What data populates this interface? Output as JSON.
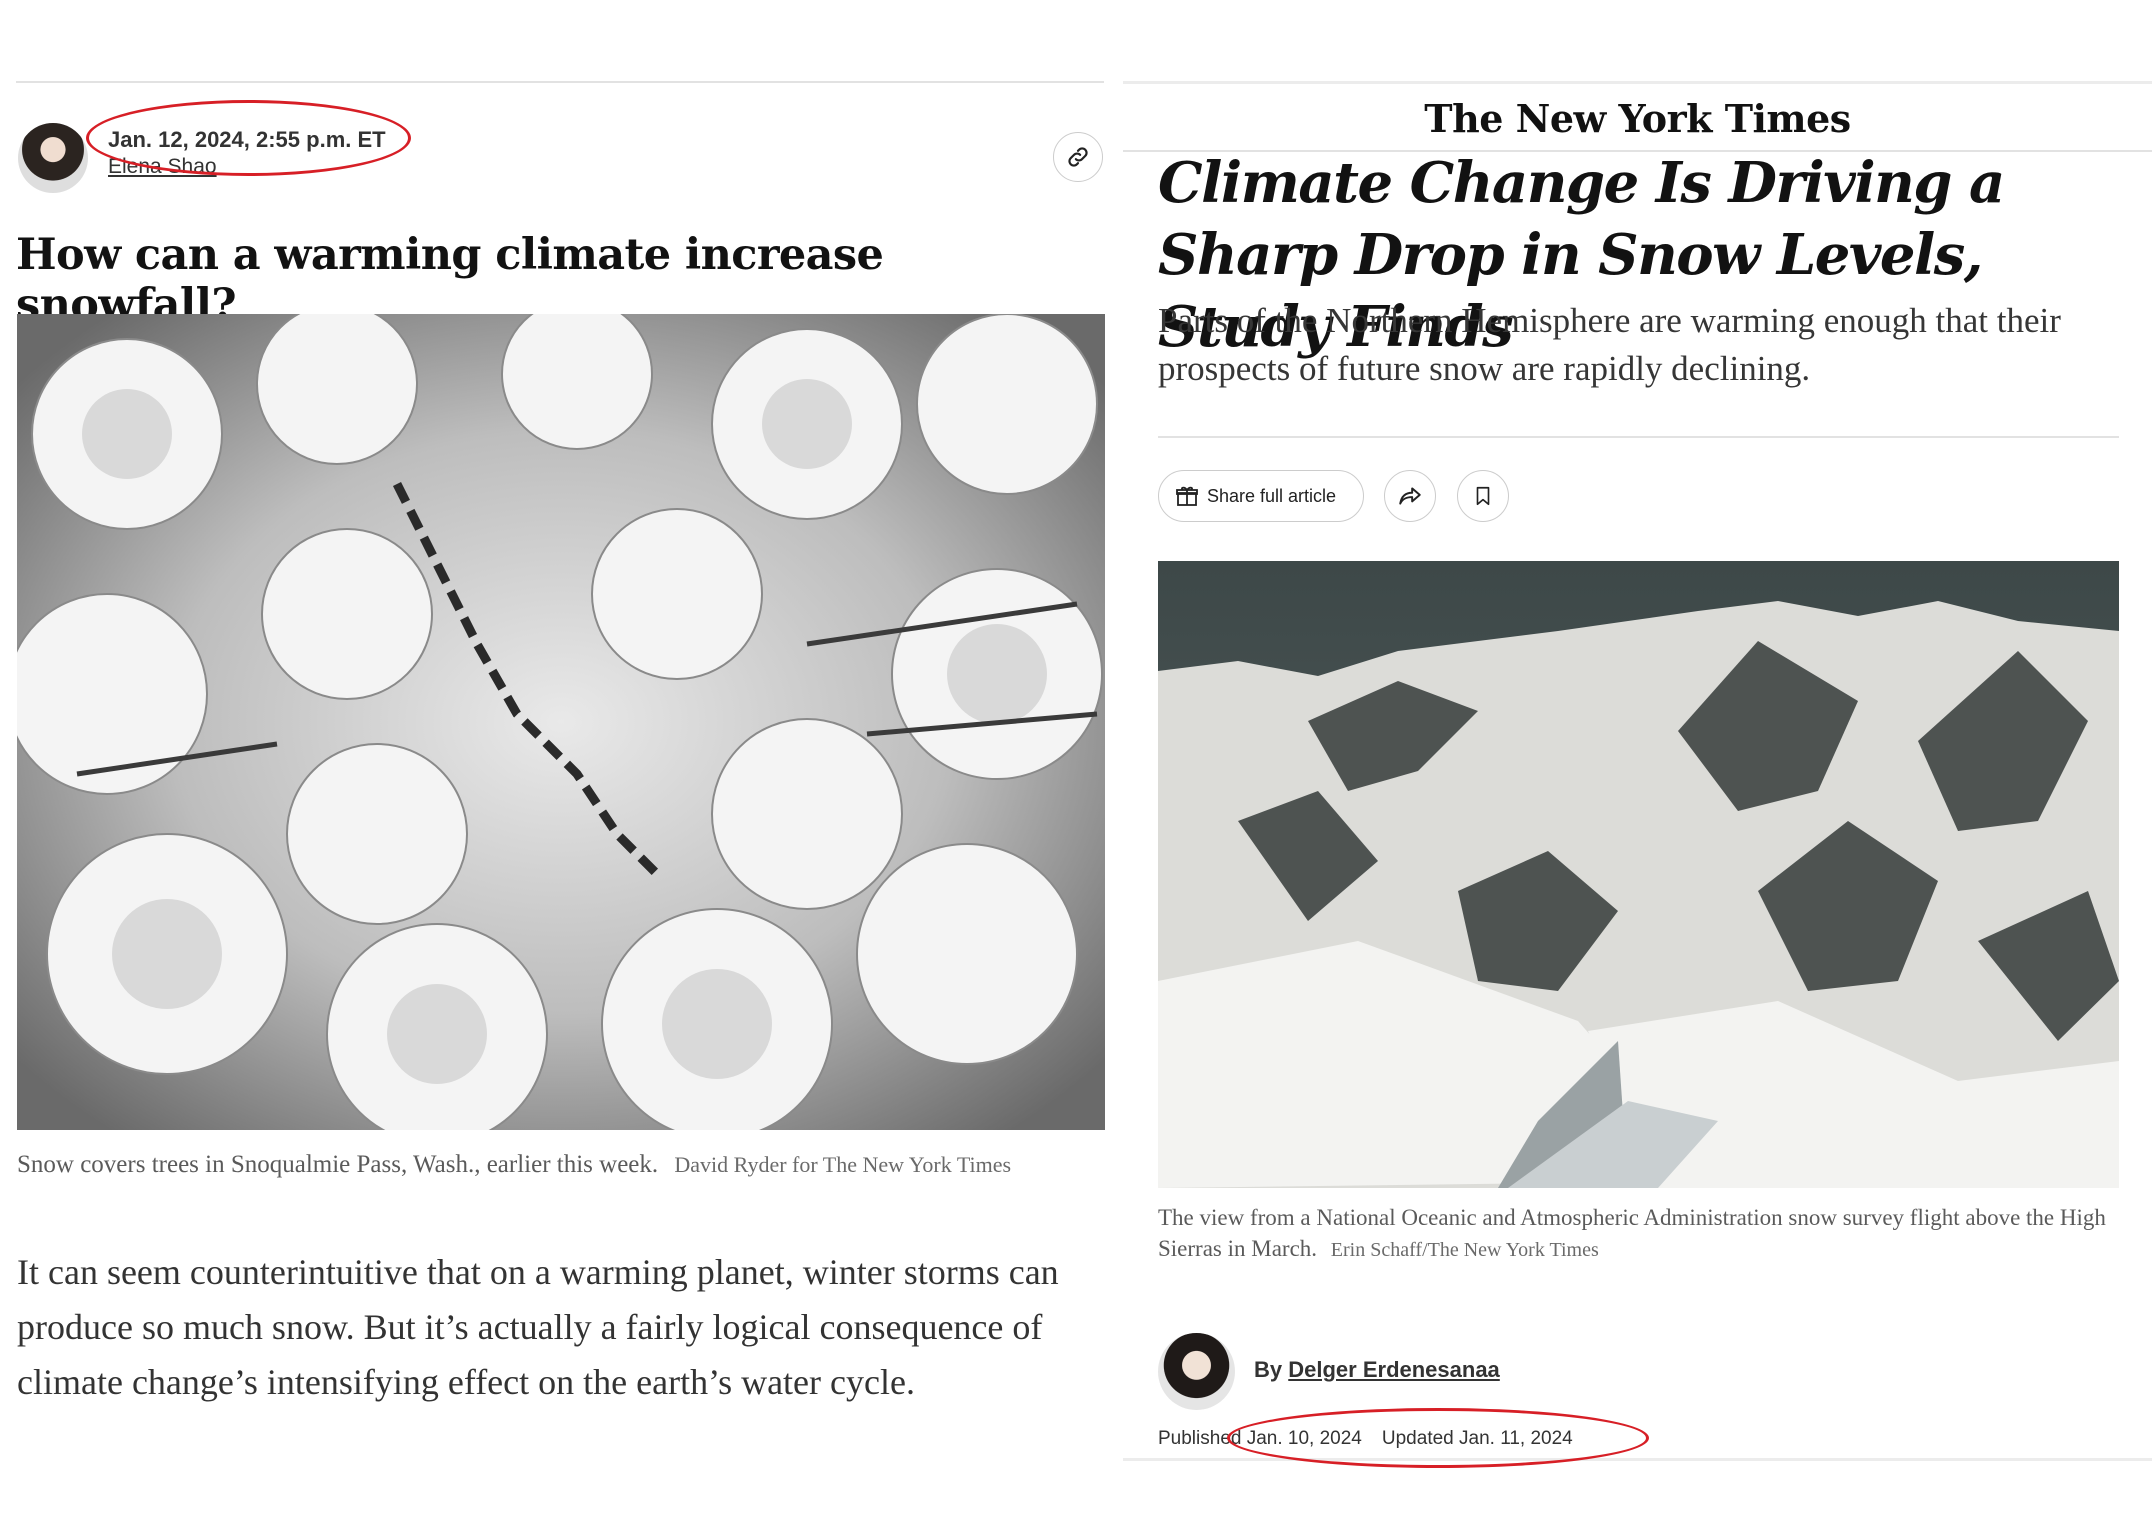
{
  "left": {
    "date": "Jan. 12, 2024, 2:55 p.m. ET",
    "author": "Elena Shao",
    "headline": "How can a warming climate increase snowfall?",
    "caption": "Snow covers trees in Snoqualmie Pass, Wash., earlier this week.",
    "credit": "David Ryder for The New York Times",
    "body": "It can seem counterintuitive that on a warming planet, winter storms can produce so much snow. But it’s actually a fairly logical consequence of climate change’s intensifying effect on the earth’s water cycle."
  },
  "right": {
    "masthead": "The New York Times",
    "headline": "Climate Change Is Driving a Sharp Drop in Snow Levels, Study Finds",
    "summary": "Parts of the Northern Hemisphere are warming enough that their prospects of future snow are rapidly declining.",
    "share_label": "Share full article",
    "caption": "The view from a National Oceanic and Atmospheric Administration snow survey flight above the High Sierras in March.",
    "credit": "Erin Schaff/The New York Times",
    "byline_prefix": "By",
    "author": "Delger Erdenesanaa",
    "published": "Published Jan. 10, 2024",
    "updated": "Updated Jan. 11, 2024"
  },
  "icons": [
    "link-icon",
    "gift-icon",
    "share-arrow-icon",
    "bookmark-icon"
  ],
  "colors": {
    "annotation": "#d71f26"
  }
}
